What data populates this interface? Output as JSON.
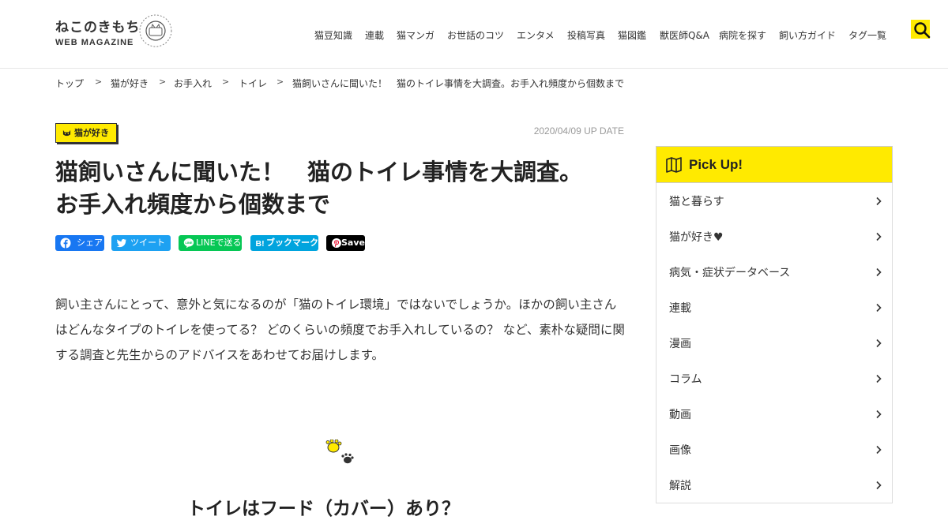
{
  "header": {
    "logo_jp": "ねこのきもち",
    "logo_en": "WEB MAGAZINE",
    "nav": [
      "猫豆知識",
      "連載",
      "猫マンガ",
      "お世話のコツ",
      "エンタメ",
      "投稿写真",
      "猫図鑑",
      "獣医師Q&A",
      "病院を探す",
      "飼い方ガイド",
      "タグ一覧"
    ],
    "search_icon": "search-icon"
  },
  "breadcrumb": {
    "items": [
      "トップ",
      "猫が好き",
      "お手入れ",
      "トイレ",
      "猫飼いさんに聞いた！　猫のトイレ事情を大調査。お手入れ頻度から個数まで"
    ],
    "separator": ">"
  },
  "article": {
    "category": "猫が好き",
    "date": "2020/04/09 UP DATE",
    "title_line1": "猫飼いさんに聞いた！　猫のトイレ事情を大調査。",
    "title_line2": "お手入れ頻度から個数まで",
    "share": {
      "facebook": "シェア",
      "twitter": "ツイート",
      "line": "LINEで送る",
      "hatena": "ブックマーク",
      "pinterest": "Save"
    },
    "lead": "飼い主さんにとって、意外と気になるのが「猫のトイレ環境」ではないでしょうか。ほかの飼い主さんはどんなタイプのトイレを使ってる？ どのくらいの頻度でお手入れしているの？ など、素朴な疑問に関する調査と先生からのアドバイスをあわせてお届けします。",
    "subheading": "トイレはフード（カバー）あり？"
  },
  "sidebar": {
    "pickup_label": "Pick Up!",
    "items": [
      "猫と暮らす",
      "猫が好き♥",
      "病気・症状データベース",
      "連載",
      "漫画",
      "コラム",
      "動画",
      "画像",
      "解説"
    ]
  },
  "colors": {
    "accent": "#ffea00",
    "facebook": "#1877f2",
    "twitter": "#1da1f2",
    "line": "#06c755",
    "hatena": "#00a4de",
    "pinterest": "#000000"
  }
}
